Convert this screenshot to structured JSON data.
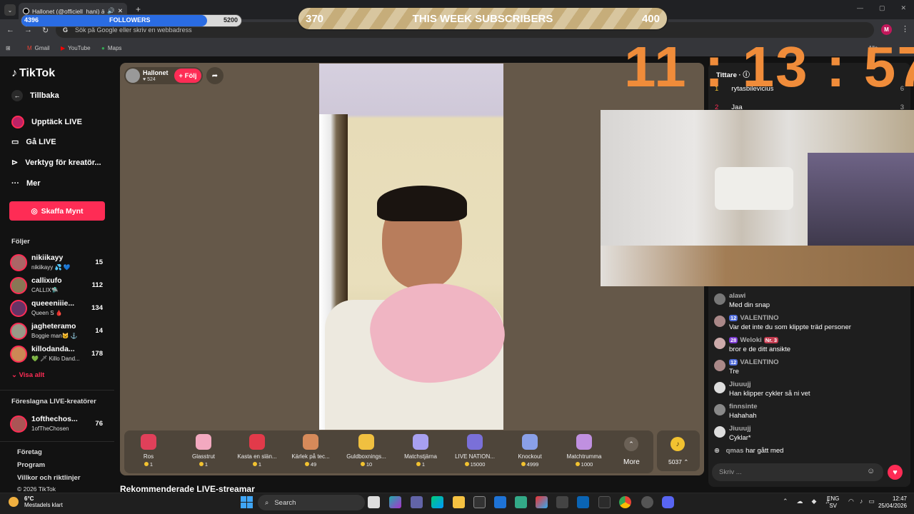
{
  "browser": {
    "tab_title": "Hallonet (@officiell_hani) ä",
    "new_tab": "+",
    "address_placeholder": "Sök på Google eller skriv en webbadress",
    "profile_initial": "M",
    "bookmarks": [
      "Gmail",
      "YouTube",
      "Maps"
    ],
    "bookmarks_right": "Alla"
  },
  "overlay": {
    "followers": {
      "current": "4396",
      "label": "FOLLOWERS",
      "goal": "5200",
      "progress": 0.845
    },
    "subscribers": {
      "current": "370",
      "label": "THIS WEEK SUBSCRIBERS",
      "goal": "400"
    },
    "clock": "11 : 13 : 57"
  },
  "sidebar": {
    "logo": "TikTok",
    "back": "Tillbaka",
    "nav": [
      "Upptäck LIVE",
      "Gå LIVE",
      "Verktyg för kreatör...",
      "Mer"
    ],
    "coins_button": "Skaffa Mynt",
    "following_title": "Följer",
    "following": [
      {
        "name": "nikiikayy",
        "sub": "nikiikayy 💦 💙",
        "count": "15"
      },
      {
        "name": "callixufo",
        "sub": "CALLIX🛸",
        "count": "112"
      },
      {
        "name": "queeeniiie...",
        "sub": "Queen S 🩸",
        "count": "134"
      },
      {
        "name": "jagheteramo",
        "sub": "Boggie man🐱 ⚓",
        "count": "14"
      },
      {
        "name": "killodanda...",
        "sub": "💚 🗡 Killo Dand...",
        "count": "178"
      }
    ],
    "see_all": "Visa allt",
    "suggested_title": "Föreslagna LIVE-kreatörer",
    "suggested": [
      {
        "name": "1ofthechos...",
        "sub": "1ofTheChosen",
        "count": "76"
      }
    ],
    "footer": [
      "Företag",
      "Program",
      "Villkor och riktlinjer",
      "© 2026 TikTok"
    ]
  },
  "stream": {
    "host_name": "Hallonet",
    "host_likes": "524",
    "follow": "+ Följ",
    "gifts": [
      {
        "name": "Ros",
        "price": "1",
        "color": "#e0405a"
      },
      {
        "name": "Glasstrut",
        "price": "1",
        "color": "#f3a9c0"
      },
      {
        "name": "Kasta en slän...",
        "price": "1",
        "color": "#e23a4a"
      },
      {
        "name": "Kärlek på tec...",
        "price": "49",
        "color": "#d68a5a"
      },
      {
        "name": "Guldboxnings...",
        "price": "10",
        "color": "#f0c040"
      },
      {
        "name": "Matchstjärna",
        "price": "1",
        "color": "#a8a0f0"
      },
      {
        "name": "LIVE NATION...",
        "price": "15000",
        "color": "#7a70d8"
      },
      {
        "name": "Knockout",
        "price": "4999",
        "color": "#8aa0e8"
      },
      {
        "name": "Matchtrumma",
        "price": "1000",
        "color": "#c090e0"
      }
    ],
    "more": "More",
    "coin_balance": "5037",
    "recommended": "Rekommenderade LIVE-streamar"
  },
  "viewers": {
    "title": "Tittare",
    "list": [
      {
        "rank": "1",
        "name": "rytasbilevicius",
        "count": "6"
      },
      {
        "rank": "2",
        "name": "Jaa",
        "count": "3"
      }
    ]
  },
  "chat": {
    "messages": [
      {
        "user": "alawi",
        "text": "Med din snap",
        "badge": ""
      },
      {
        "user": "VALENTINO",
        "text": "Var det inte du som klippte träd personer",
        "badge": "12"
      },
      {
        "user": "Weloki",
        "text": "bror e de ditt ansikte",
        "badge": "28",
        "extra": "Nr. 3"
      },
      {
        "user": "VALENTINO",
        "text": "Tre",
        "badge": "12"
      },
      {
        "user": "Jiuuujj",
        "text": "Han klipper cykler så ni vet",
        "badge": ""
      },
      {
        "user": "finnsinte",
        "text": "Hahahah",
        "badge": ""
      },
      {
        "user": "Jiuuujj",
        "text": "Cyklar*",
        "badge": ""
      }
    ],
    "join": {
      "user": "qmas",
      "text": "har gått med"
    },
    "input_placeholder": "Skriv ..."
  },
  "taskbar": {
    "weather_temp": "6°C",
    "weather_desc": "Mestadels klart",
    "search": "Search",
    "lang1": "ENG",
    "lang2": "SV",
    "time": "12:47",
    "date": "25/04/2026"
  }
}
